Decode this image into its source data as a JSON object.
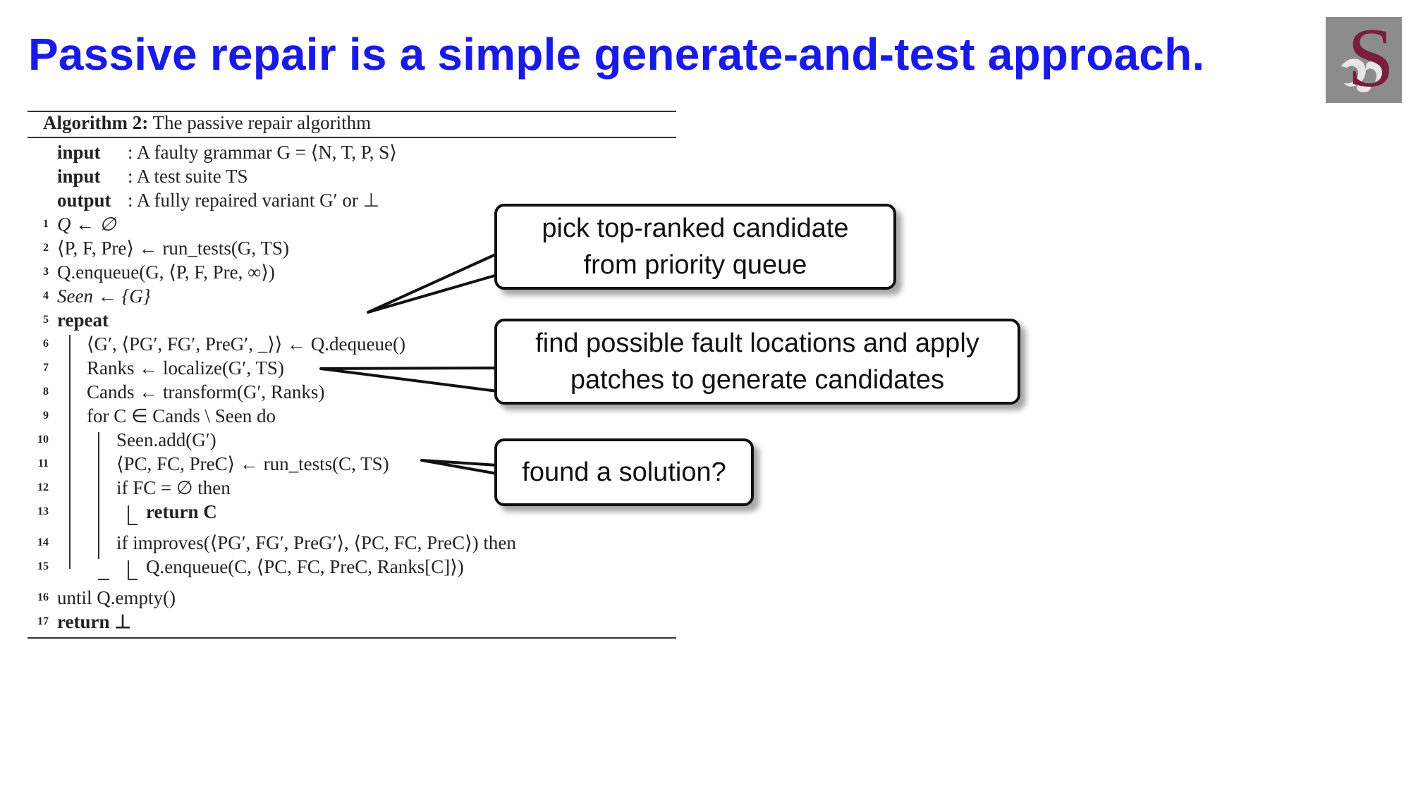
{
  "slide": {
    "title": "Passive repair is a simple generate-and-test approach.",
    "title_color": "#1a1ae6"
  },
  "logo": {
    "icon": "university-crest-logo",
    "letter": "S"
  },
  "algorithm": {
    "caption_label": "Algorithm 2:",
    "caption_text": "The passive repair algorithm",
    "io": [
      {
        "key": "input",
        "sep": ":",
        "text": "A faulty grammar G = ⟨N, T, P, S⟩"
      },
      {
        "key": "input",
        "sep": ":",
        "text": "A test suite TS"
      },
      {
        "key": "output",
        "sep": ":",
        "text": "A fully repaired variant G′ or ⊥"
      }
    ],
    "lines": [
      {
        "n": "1",
        "text": "Q ← ∅"
      },
      {
        "n": "2",
        "text": "⟨P, F, Pre⟩ ← run_tests(G, TS)"
      },
      {
        "n": "3",
        "text": "Q.enqueue(G, ⟨P, F, Pre, ∞⟩)"
      },
      {
        "n": "4",
        "text": "Seen ← {G}"
      },
      {
        "n": "5",
        "text": "repeat"
      },
      {
        "n": "6",
        "text": "⟨G′, ⟨PG′, FG′, PreG′, _⟩⟩ ← Q.dequeue()"
      },
      {
        "n": "7",
        "text": "Ranks ← localize(G′, TS)"
      },
      {
        "n": "8",
        "text": "Cands ← transform(G′, Ranks)"
      },
      {
        "n": "9",
        "text": "for C ∈ Cands \\ Seen do"
      },
      {
        "n": "10",
        "text": "Seen.add(G′)"
      },
      {
        "n": "11",
        "text": "⟨PC, FC, PreC⟩ ← run_tests(C, TS)"
      },
      {
        "n": "12",
        "text": "if FC = ∅ then"
      },
      {
        "n": "13",
        "text": "return C"
      },
      {
        "n": "14",
        "text": "if improves(⟨PG′, FG′, PreG′⟩, ⟨PC, FC, PreC⟩) then"
      },
      {
        "n": "15",
        "text": "Q.enqueue(C, ⟨PC, FC, PreC, Ranks[C]⟩)"
      },
      {
        "n": "16",
        "text": "until Q.empty()"
      },
      {
        "n": "17",
        "text": "return ⊥"
      }
    ]
  },
  "callouts": [
    {
      "text": "pick top-ranked candidate from priority queue"
    },
    {
      "text": "find possible fault locations and apply patches to generate candidates"
    },
    {
      "text": "found a solution?"
    }
  ]
}
